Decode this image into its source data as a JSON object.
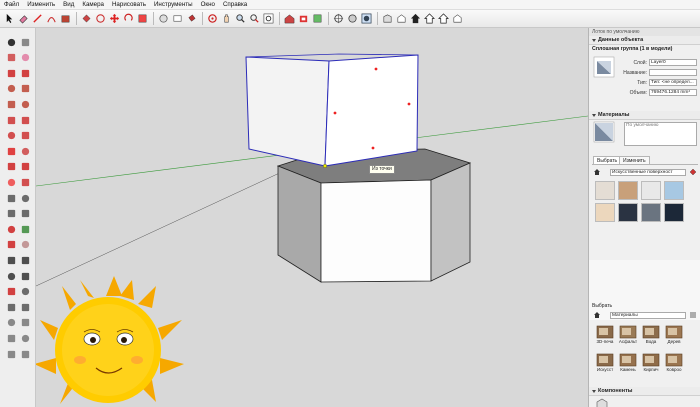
{
  "menu": [
    "Файл",
    "Изменить",
    "Вид",
    "Камера",
    "Нарисовать",
    "Инструменты",
    "Окно",
    "Справка"
  ],
  "viewport": {
    "tooltip": "Из точки"
  },
  "tray": {
    "title": "Лоток по умолчанию",
    "entity_section": "Данные объекта",
    "entity_name": "Сплошная группа (1 в модели)",
    "labels": {
      "layer": "Слой:",
      "name": "Название:",
      "type": "Тип:",
      "volume": "Объем:"
    },
    "values": {
      "layer": "Layer0",
      "name": "",
      "type": "Тип: <не определ...",
      "volume": "769476.1284 mm³"
    },
    "materials_section": "Материалы",
    "material_name": "По умолчанию",
    "tab_select": "Выбрать",
    "tab_edit": "Изменить",
    "library": "Искусственные поверхност",
    "swatch_colors": [
      "#e4ddd4",
      "#c8a07a",
      "#e8e8e8",
      "#a7c8e3",
      "#ecd7bd",
      "#2a3342",
      "#6a7480",
      "#1c2838"
    ],
    "components_select": "Выбрать",
    "components_library": "Материалы",
    "material_tiles": [
      {
        "name": "3D-печа",
        "color": "#8a6a4a"
      },
      {
        "name": "Асфальт",
        "color": "#9a7a55"
      },
      {
        "name": "Вода",
        "color": "#8c6d4c"
      },
      {
        "name": "Дерев",
        "color": "#9b7651"
      },
      {
        "name": "Искусст",
        "color": "#8a6a4a"
      },
      {
        "name": "Камень",
        "color": "#96714d"
      },
      {
        "name": "Кирпич",
        "color": "#8f6c49"
      },
      {
        "name": "Ковроо",
        "color": "#9a7550"
      }
    ],
    "components_section": "Компоненты"
  }
}
